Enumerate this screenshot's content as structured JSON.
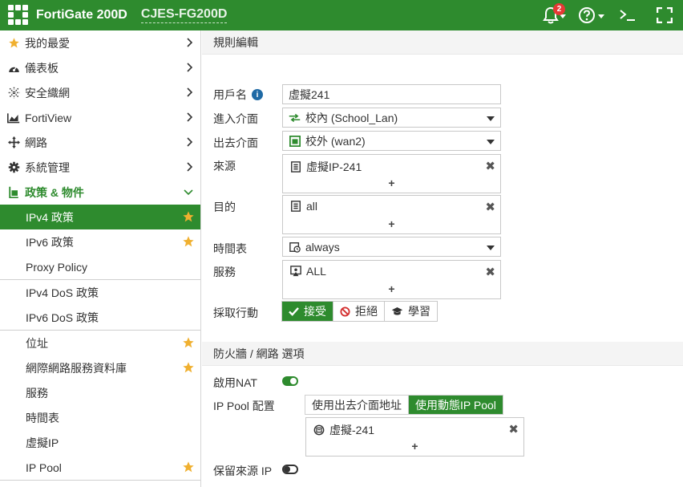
{
  "header": {
    "product": "FortiGate 200D",
    "hostname": "CJES-FG200D",
    "notification_count": "2",
    "icons": [
      "bell-icon",
      "help-icon",
      "cli-console-icon",
      "fullscreen-icon"
    ]
  },
  "sidebar": {
    "items": [
      {
        "label": "我的最愛",
        "icon": "star-icon"
      },
      {
        "label": "儀表板",
        "icon": "dashboard-icon"
      },
      {
        "label": "安全織網",
        "icon": "security-fabric-icon"
      },
      {
        "label": "FortiView",
        "icon": "chart-icon"
      },
      {
        "label": "網路",
        "icon": "network-icon"
      },
      {
        "label": "系統管理",
        "icon": "gear-icon"
      },
      {
        "label": "政策 & 物件",
        "icon": "policy-icon"
      }
    ],
    "sub_items": [
      {
        "label": "IPv4 政策",
        "starred": true,
        "active": true
      },
      {
        "label": "IPv6 政策",
        "starred": true
      },
      {
        "label": "Proxy Policy",
        "starred": false
      },
      {
        "label": "IPv4 DoS 政策",
        "starred": false
      },
      {
        "label": "IPv6 DoS 政策",
        "starred": false
      },
      {
        "label": "位址",
        "starred": true
      },
      {
        "label": "網際網路服務資料庫",
        "starred": true
      },
      {
        "label": "服務",
        "starred": false
      },
      {
        "label": "時間表",
        "starred": false
      },
      {
        "label": "虛擬IP",
        "starred": false
      },
      {
        "label": "IP Pool",
        "starred": true
      }
    ]
  },
  "main": {
    "section_title": "規則編輯",
    "name_label": "用戶名",
    "name_value": "虛擬241",
    "incoming_label": "進入介面",
    "incoming_value": "校內 (School_Lan)",
    "outgoing_label": "出去介面",
    "outgoing_value": "校外 (wan2)",
    "source_label": "來源",
    "source_value": "虛擬IP-241",
    "destination_label": "目的",
    "destination_value": "all",
    "schedule_label": "時間表",
    "schedule_value": "always",
    "service_label": "服務",
    "service_value": "ALL",
    "action_label": "採取行動",
    "actions": [
      "接受",
      "拒絕",
      "學習"
    ],
    "selected_action": "接受",
    "plus": "+",
    "remove": "✖",
    "firewall_section_title": "防火牆 / 網路 選項",
    "nat_label": "啟用NAT",
    "nat_enabled": true,
    "ippool_label": "IP Pool 配置",
    "ippool_options": [
      "使用出去介面地址",
      "使用動態IP Pool"
    ],
    "ippool_selected": "使用動態IP Pool",
    "ippool_value": "虛擬-241",
    "preserve_label": "保留來源 IP",
    "preserve_enabled": false
  },
  "colors": {
    "accent": "#2e8b2e",
    "badge": "#e53935",
    "star": "#f0b030"
  }
}
